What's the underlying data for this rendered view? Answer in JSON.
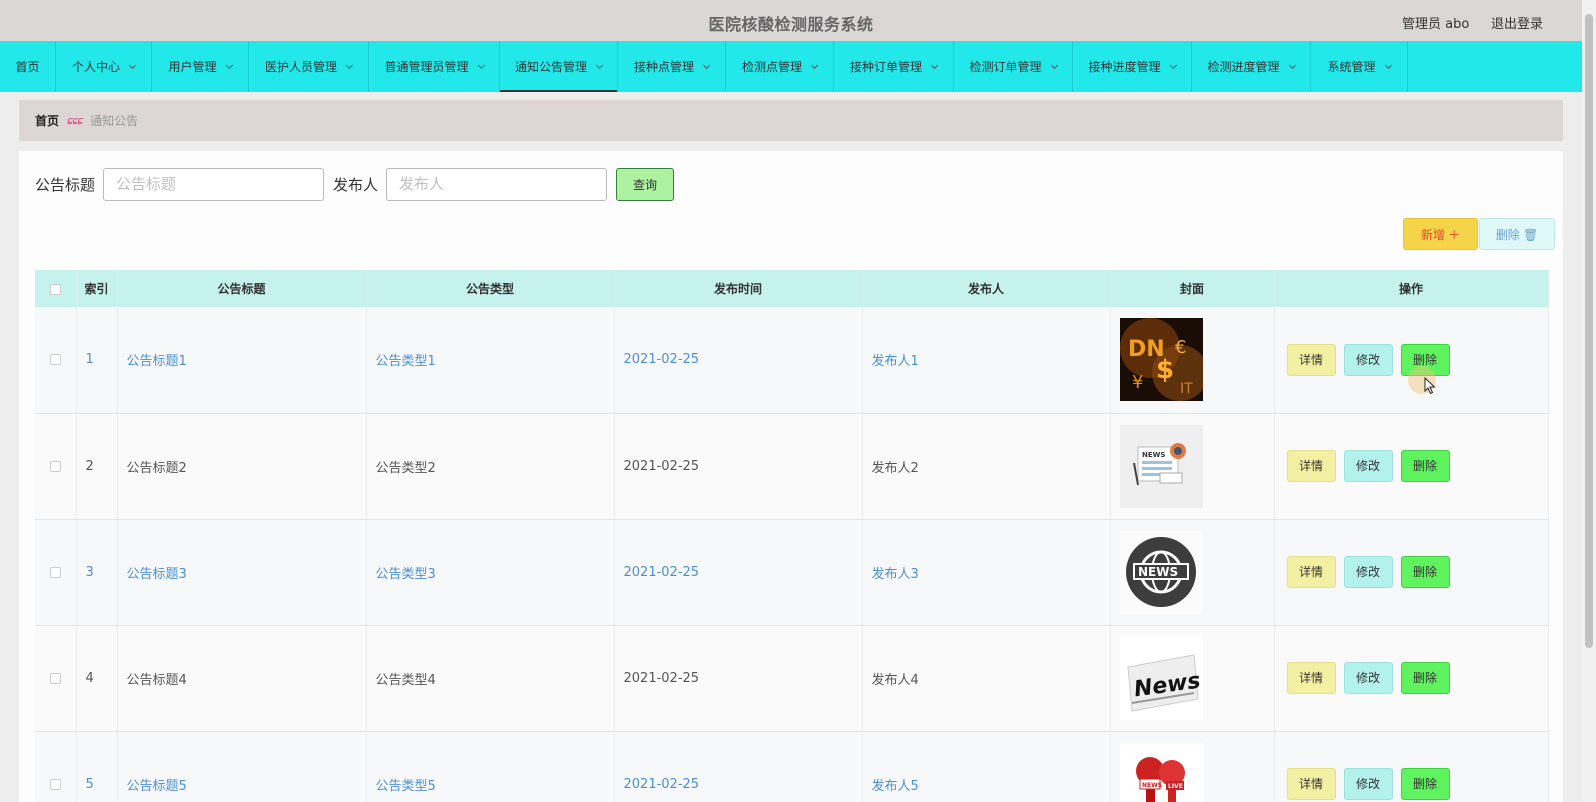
{
  "header": {
    "title": "医院核酸检测服务系统",
    "user": "管理员 abo",
    "logout": "退出登录"
  },
  "nav": [
    {
      "label": "首页",
      "dropdown": false
    },
    {
      "label": "个人中心",
      "dropdown": true
    },
    {
      "label": "用户管理",
      "dropdown": true
    },
    {
      "label": "医护人员管理",
      "dropdown": true
    },
    {
      "label": "普通管理员管理",
      "dropdown": true
    },
    {
      "label": "通知公告管理",
      "dropdown": true,
      "active": true
    },
    {
      "label": "接种点管理",
      "dropdown": true
    },
    {
      "label": "检测点管理",
      "dropdown": true
    },
    {
      "label": "接种订单管理",
      "dropdown": true
    },
    {
      "label": "检测订单管理",
      "dropdown": true
    },
    {
      "label": "接种进度管理",
      "dropdown": true
    },
    {
      "label": "检测进度管理",
      "dropdown": true
    },
    {
      "label": "系统管理",
      "dropdown": true
    }
  ],
  "breadcrumb": {
    "home": "首页",
    "current": "通知公告"
  },
  "search": {
    "title_label": "公告标题",
    "title_placeholder": "公告标题",
    "publisher_label": "发布人",
    "publisher_placeholder": "发布人",
    "query": "查询"
  },
  "actions": {
    "add": "新增 ＋",
    "delete": "删除 🗑"
  },
  "table": {
    "headers": [
      "",
      "索引",
      "公告标题",
      "公告类型",
      "发布时间",
      "发布人",
      "封面",
      "操作"
    ],
    "rows": [
      {
        "index": "1",
        "title": "公告标题1",
        "type": "公告类型1",
        "time": "2021-02-25",
        "publisher": "发布人1",
        "cover": "dollar-letters-image",
        "link": true
      },
      {
        "index": "2",
        "title": "公告标题2",
        "type": "公告类型2",
        "time": "2021-02-25",
        "publisher": "发布人2",
        "cover": "news-paper-illustration",
        "link": false
      },
      {
        "index": "3",
        "title": "公告标题3",
        "type": "公告类型3",
        "time": "2021-02-25",
        "publisher": "发布人3",
        "cover": "news-globe-icon",
        "link": true
      },
      {
        "index": "4",
        "title": "公告标题4",
        "type": "公告类型4",
        "time": "2021-02-25",
        "publisher": "发布人4",
        "cover": "newspaper-image",
        "link": false
      },
      {
        "index": "5",
        "title": "公告标题5",
        "type": "公告类型5",
        "time": "2021-02-25",
        "publisher": "发布人5",
        "cover": "live-microphones-image",
        "link": true
      }
    ],
    "ops": {
      "detail": "详情",
      "edit": "修改",
      "delete": "删除"
    }
  },
  "colors": {
    "nav_bg": "#22e8ea",
    "header_bg": "#dbd7d7",
    "table_header_bg": "#c6f2ee",
    "link": "#4a8fd6"
  }
}
